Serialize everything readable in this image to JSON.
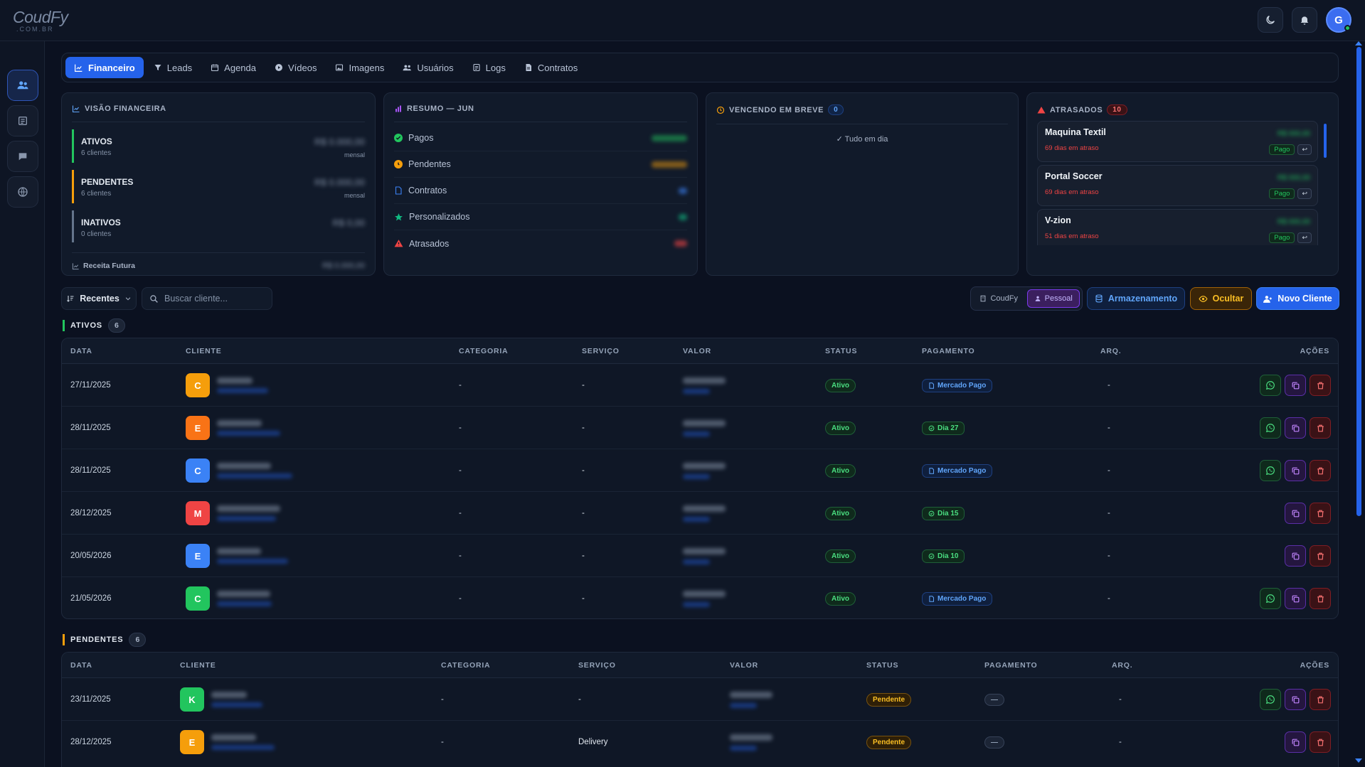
{
  "brand": {
    "name": "CoudFy",
    "domain": ".COM.BR"
  },
  "user": {
    "initial": "G"
  },
  "nav_tabs": [
    {
      "label": "Financeiro",
      "icon": "chart-line-icon",
      "active": true
    },
    {
      "label": "Leads",
      "icon": "filter-icon"
    },
    {
      "label": "Agenda",
      "icon": "calendar-icon"
    },
    {
      "label": "Vídeos",
      "icon": "play-icon"
    },
    {
      "label": "Imagens",
      "icon": "image-icon"
    },
    {
      "label": "Usuários",
      "icon": "users-icon"
    },
    {
      "label": "Logs",
      "icon": "file-icon"
    },
    {
      "label": "Contratos",
      "icon": "document-icon"
    }
  ],
  "visao": {
    "title": "VISÃO FINANCEIRA",
    "rows": [
      {
        "label": "ATIVOS",
        "sub": "6 clientes",
        "amount": "R$ 0.000,00",
        "note": "mensal",
        "color": "#22c55e"
      },
      {
        "label": "PENDENTES",
        "sub": "6 clientes",
        "amount": "R$ 0.000,00",
        "note": "mensal",
        "color": "#f59e0b"
      },
      {
        "label": "INATIVOS",
        "sub": "0 clientes",
        "amount": "R$ 0,00",
        "note": "",
        "color": "#64748b"
      }
    ],
    "future_label": "Receita Futura",
    "future_amount": "R$ 0.000,00"
  },
  "resumo": {
    "title": "RESUMO — JUN",
    "rows": [
      {
        "label": "Pagos",
        "color": "#22c55e"
      },
      {
        "label": "Pendentes",
        "color": "#f59e0b"
      },
      {
        "label": "Contratos",
        "color": "#3b82f6"
      },
      {
        "label": "Personalizados",
        "color": "#10b981"
      },
      {
        "label": "Atrasados",
        "color": "#ef4444"
      }
    ]
  },
  "vencendo": {
    "title": "VENCENDO EM BREVE",
    "count": "0",
    "empty": "Tudo em dia"
  },
  "atrasados": {
    "title": "ATRASADOS",
    "count": "10",
    "items": [
      {
        "name": "Maquina Textil",
        "days": "69 dias em atraso",
        "amount": "R$ 000,00",
        "pago": "Pago"
      },
      {
        "name": "Portal Soccer",
        "days": "69 dias em atraso",
        "amount": "R$ 000,00",
        "pago": "Pago"
      },
      {
        "name": "V-zion",
        "days": "51 dias em atraso",
        "amount": "R$ 000,00",
        "pago": "Pago"
      }
    ]
  },
  "toolbar": {
    "sort_label": "Recentes",
    "search_placeholder": "Buscar cliente...",
    "seg_a": "CoudFy",
    "seg_b": "Pessoal",
    "storage": "Armazenamento",
    "hide": "Ocultar",
    "new_client": "Novo Cliente"
  },
  "ativos": {
    "label": "ATIVOS",
    "count": "6",
    "headers": [
      "DATA",
      "CLIENTE",
      "CATEGORIA",
      "SERVIÇO",
      "VALOR",
      "STATUS",
      "PAGAMENTO",
      "ARQ.",
      "AÇÕES"
    ],
    "rows": [
      {
        "date": "27/11/2025",
        "initial": "C",
        "color": "#f59e0b",
        "categoria": "-",
        "servico": "-",
        "status": "Ativo",
        "pay_type": "mp",
        "pay": "Mercado Pago",
        "arq": "-",
        "wa": true
      },
      {
        "date": "28/11/2025",
        "initial": "E",
        "color": "#f97316",
        "categoria": "-",
        "servico": "-",
        "status": "Ativo",
        "pay_type": "dia",
        "pay": "Dia 27",
        "arq": "-",
        "wa": true
      },
      {
        "date": "28/11/2025",
        "initial": "C",
        "color": "#3b82f6",
        "categoria": "-",
        "servico": "-",
        "status": "Ativo",
        "pay_type": "mp",
        "pay": "Mercado Pago",
        "arq": "-",
        "wa": true
      },
      {
        "date": "28/12/2025",
        "initial": "M",
        "color": "#ef4444",
        "categoria": "-",
        "servico": "-",
        "status": "Ativo",
        "pay_type": "dia",
        "pay": "Dia 15",
        "arq": "-",
        "wa": false
      },
      {
        "date": "20/05/2026",
        "initial": "E",
        "color": "#3b82f6",
        "categoria": "-",
        "servico": "-",
        "status": "Ativo",
        "pay_type": "dia",
        "pay": "Dia 10",
        "arq": "-",
        "wa": false
      },
      {
        "date": "21/05/2026",
        "initial": "C",
        "color": "#22c55e",
        "categoria": "-",
        "servico": "-",
        "status": "Ativo",
        "pay_type": "mp",
        "pay": "Mercado Pago",
        "arq": "-",
        "wa": true
      }
    ]
  },
  "pendentes": {
    "label": "PENDENTES",
    "count": "6",
    "headers": [
      "DATA",
      "CLIENTE",
      "CATEGORIA",
      "SERVIÇO",
      "VALOR",
      "STATUS",
      "PAGAMENTO",
      "ARQ.",
      "AÇÕES"
    ],
    "rows": [
      {
        "date": "23/11/2025",
        "initial": "K",
        "color": "#22c55e",
        "categoria": "-",
        "servico": "-",
        "status": "Pendente",
        "pay": "—",
        "arq": "-",
        "wa": true
      },
      {
        "date": "28/12/2025",
        "initial": "E",
        "color": "#f59e0b",
        "categoria": "-",
        "servico": "Delivery",
        "status": "Pendente",
        "pay": "—",
        "arq": "-",
        "wa": false
      }
    ]
  }
}
